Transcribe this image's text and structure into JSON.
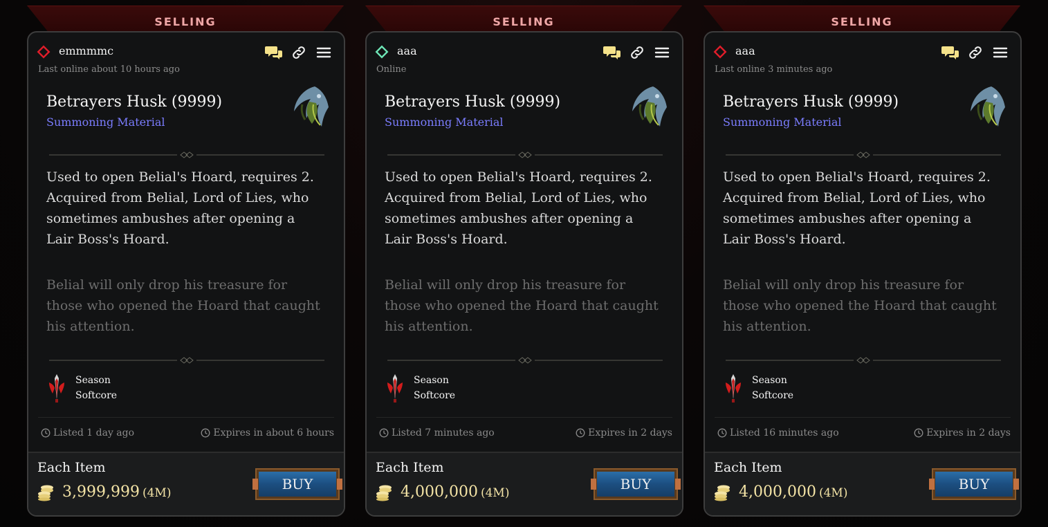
{
  "cards": [
    {
      "banner": "SELLING",
      "seller": {
        "name": "emmmmc",
        "status": "Last online about 10 hours ago",
        "status_color": "#e11d2a"
      },
      "item": {
        "name": "Betrayers Husk (9999)",
        "type": "Summoning Material",
        "description": "Used to open Belial's Hoard, requires 2. Acquired from Belial, Lord of Lies, who sometimes ambushes after opening a Lair Boss's Hoard.",
        "flavor": "Belial will only drop his treasure for those who opened the Hoard that caught his attention."
      },
      "realm": {
        "line1": "Season",
        "line2": "Softcore"
      },
      "listed": "Listed 1 day ago",
      "expires": "Expires in about 6 hours",
      "footer": {
        "label": "Each Item",
        "price": "3,999,999",
        "price_short": "(4M)",
        "buy": "BUY"
      }
    },
    {
      "banner": "SELLING",
      "seller": {
        "name": "aaa",
        "status": "Online",
        "status_color": "#6ee7b7"
      },
      "item": {
        "name": "Betrayers Husk (9999)",
        "type": "Summoning Material",
        "description": "Used to open Belial's Hoard, requires 2. Acquired from Belial, Lord of Lies, who sometimes ambushes after opening a Lair Boss's Hoard.",
        "flavor": "Belial will only drop his treasure for those who opened the Hoard that caught his attention."
      },
      "realm": {
        "line1": "Season",
        "line2": "Softcore"
      },
      "listed": "Listed 7 minutes ago",
      "expires": "Expires in 2 days",
      "footer": {
        "label": "Each Item",
        "price": "4,000,000",
        "price_short": "(4M)",
        "buy": "BUY"
      }
    },
    {
      "banner": "SELLING",
      "seller": {
        "name": "aaa",
        "status": "Last online 3 minutes ago",
        "status_color": "#e11d2a"
      },
      "item": {
        "name": "Betrayers Husk (9999)",
        "type": "Summoning Material",
        "description": "Used to open Belial's Hoard, requires 2. Acquired from Belial, Lord of Lies, who sometimes ambushes after opening a Lair Boss's Hoard.",
        "flavor": "Belial will only drop his treasure for those who opened the Hoard that caught his attention."
      },
      "realm": {
        "line1": "Season",
        "line2": "Softcore"
      },
      "listed": "Listed 16 minutes ago",
      "expires": "Expires in 2 days",
      "footer": {
        "label": "Each Item",
        "price": "4,000,000",
        "price_short": "(4M)",
        "buy": "BUY"
      }
    }
  ],
  "icons": {
    "status": "diamond-status-icon",
    "chat": "chat-bubbles-icon",
    "link": "link-icon",
    "menu": "hamburger-menu-icon",
    "item": "betrayers-husk-item-icon",
    "realm": "seasonal-sword-icon",
    "clock": "clock-icon",
    "coins": "gold-coins-icon"
  },
  "colors": {
    "accent_banner_text": "#f0a7a7",
    "item_type": "#7b7dff",
    "price": "#f4e4a6",
    "action_icons": "#f5e28a"
  }
}
